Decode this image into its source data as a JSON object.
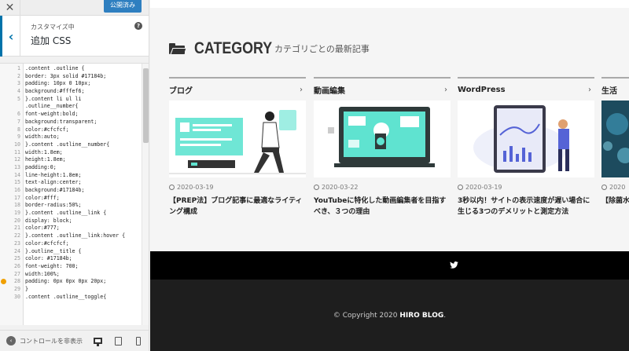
{
  "customizer": {
    "close_icon": "close-icon",
    "publish_label": "公開済み",
    "breadcrumb": "カスタマイズ中",
    "section_title": "追加 CSS",
    "help_glyph": "?",
    "hide_controls_label": "コントロールを非表示",
    "devices": [
      "desktop",
      "tablet",
      "mobile"
    ]
  },
  "code_lines": [
    {
      "n": "1",
      "t": ".content .outline {"
    },
    {
      "n": "2",
      "t": "border: 3px solid #17184b;"
    },
    {
      "n": "3",
      "t": "padding: 10px 0 10px;"
    },
    {
      "n": "4",
      "t": "background:#fffef6;"
    },
    {
      "n": "5",
      "t": "}.content li ul li"
    },
    {
      "n": "",
      "t": ".outline__number{"
    },
    {
      "n": "6",
      "t": "font-weight:bold;"
    },
    {
      "n": "7",
      "t": "background:transparent;"
    },
    {
      "n": "8",
      "t": "color:#cfcfcf;"
    },
    {
      "n": "9",
      "t": "width:auto;"
    },
    {
      "n": "10",
      "t": "}.content .outline__number{"
    },
    {
      "n": "11",
      "t": "width:1.8em;"
    },
    {
      "n": "12",
      "t": "height:1.8em;"
    },
    {
      "n": "13",
      "t": "padding:0;"
    },
    {
      "n": "14",
      "t": "line-height:1.8em;"
    },
    {
      "n": "15",
      "t": "text-align:center;"
    },
    {
      "n": "16",
      "t": "background:#17184b;"
    },
    {
      "n": "17",
      "t": "color:#fff;"
    },
    {
      "n": "18",
      "t": "border-radius:50%;"
    },
    {
      "n": "19",
      "t": "}.content .outline__link {"
    },
    {
      "n": "20",
      "t": "display: block;"
    },
    {
      "n": "21",
      "t": "color:#777;"
    },
    {
      "n": "22",
      "t": "}.content .outline__link:hover {"
    },
    {
      "n": "23",
      "t": "color:#cfcfcf;"
    },
    {
      "n": "24",
      "t": "}.outline__title {"
    },
    {
      "n": "25",
      "t": "color: #17184b;"
    },
    {
      "n": "26",
      "t": "font-weight: 700;"
    },
    {
      "n": "27",
      "t": "width:100%;"
    },
    {
      "n": "28",
      "t": "padding: 0px 0px 0px 20px;"
    },
    {
      "n": "29",
      "t": "}"
    },
    {
      "n": "30",
      "t": ".content .outline__toggle{"
    }
  ],
  "warning_line": "28",
  "preview": {
    "category_heading": "CATEGORY",
    "category_sub": "カテゴリごとの最新記事",
    "cards": [
      {
        "category": "ブログ",
        "date": "2020-03-19",
        "title": "【PREP法】ブログ記事に最適なライティング構成"
      },
      {
        "category": "動画編集",
        "date": "2020-03-22",
        "title": "YouTubeに特化した動画編集者を目指すべき、３つの理由"
      },
      {
        "category": "WordPress",
        "date": "2020-03-19",
        "title": "3秒以内！サイトの表示速度が遅い場合に生じる3つのデメリットと測定方法"
      },
      {
        "category": "生活",
        "date": "2020",
        "title": "【除菌水】を徹底解"
      }
    ],
    "chevron": "›",
    "copyright_prefix": "© Copyright 2020 ",
    "copyright_brand": "HIRO BLOG",
    "copyright_suffix": "."
  },
  "colors": {
    "accent": "#0073aa",
    "publish": "#2e7fc0",
    "illustration_teal": "#5fe3d0",
    "footer_dark": "#1e1e1e"
  }
}
